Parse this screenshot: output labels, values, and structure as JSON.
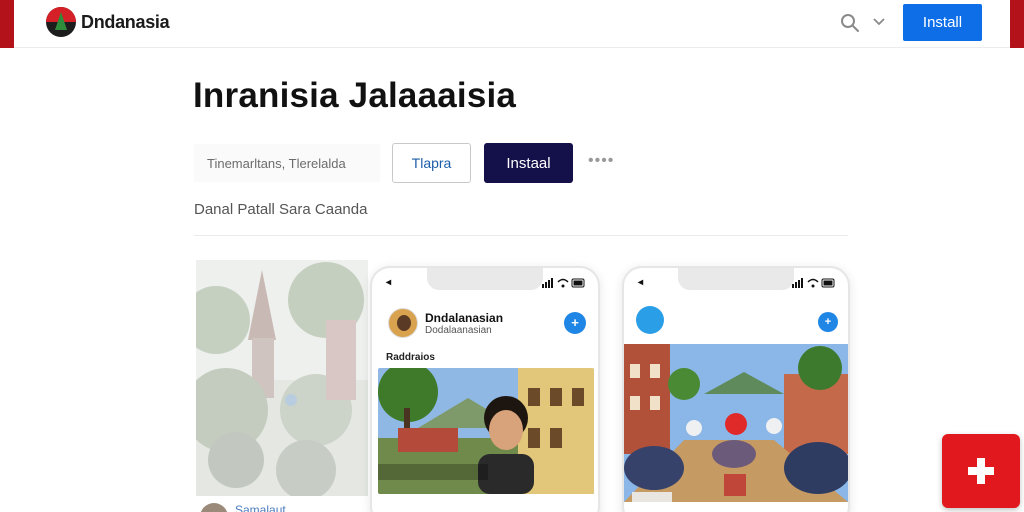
{
  "app": {
    "brand": "Dndanasia",
    "install_label": "Install"
  },
  "hero": {
    "title": "Inranisia Jalaaaisia",
    "search_placeholder": "Tinemarltans, Tlerelalda",
    "outline_button_label": "Tlapra",
    "primary_button_label": "Instaal",
    "more_label": "••••",
    "subtitle": "Danal Patall Sara Caanda"
  },
  "background_card": {
    "caption": "Samalaut"
  },
  "phone1": {
    "time": "◂",
    "profile_name": "Dndalanasian",
    "profile_handle": "Dodalaanasian",
    "action_label": "+",
    "section_title": "Raddraios"
  },
  "phone2": {
    "time": "◂",
    "action_label": "+"
  },
  "colors": {
    "accent": "#0d6ee8",
    "brand_red": "#e1191f",
    "dark_button": "#14104a"
  },
  "icons": {
    "search": "search-icon",
    "dropdown": "chevron-down-icon",
    "fab": "red-cross-icon"
  }
}
